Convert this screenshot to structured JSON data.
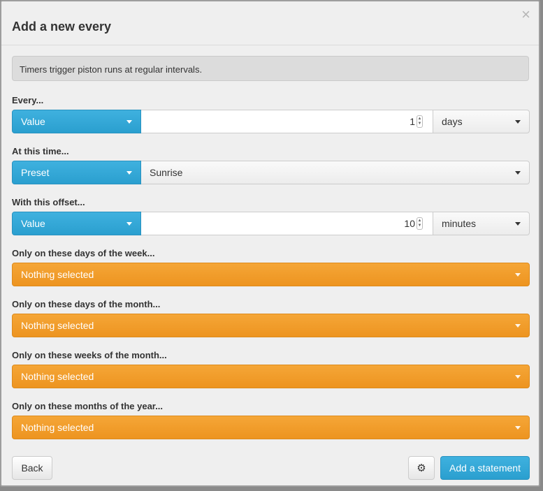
{
  "dialog": {
    "title": "Add a new every",
    "close_glyph": "×",
    "info": "Timers trigger piston runs at regular intervals."
  },
  "every": {
    "label": "Every...",
    "type": "Value",
    "value": "1",
    "unit": "days"
  },
  "at_time": {
    "label": "At this time...",
    "type": "Preset",
    "value": "Sunrise"
  },
  "offset": {
    "label": "With this offset...",
    "type": "Value",
    "value": "10",
    "unit": "minutes"
  },
  "filters": [
    {
      "label": "Only on these days of the week...",
      "value": "Nothing selected"
    },
    {
      "label": "Only on these days of the month...",
      "value": "Nothing selected"
    },
    {
      "label": "Only on these weeks of the month...",
      "value": "Nothing selected"
    },
    {
      "label": "Only on these months of the year...",
      "value": "Nothing selected"
    }
  ],
  "footer": {
    "back": "Back",
    "gear_glyph": "⚙",
    "add": "Add a statement"
  },
  "icons": {
    "close": "close-icon",
    "caret": "caret-down-icon",
    "gear": "gear-icon",
    "spinner": "spinner-icon"
  },
  "colors": {
    "accent_blue": "#2fa4d4",
    "accent_orange": "#f09a2a"
  }
}
